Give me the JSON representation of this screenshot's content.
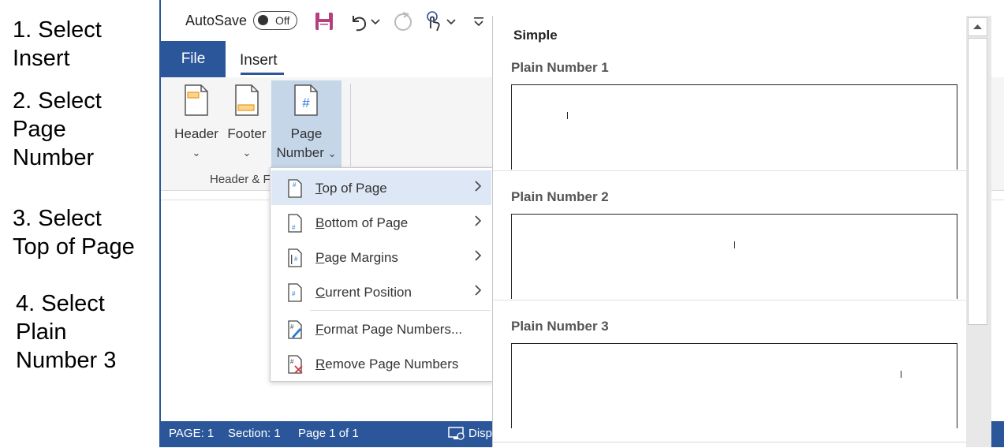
{
  "steps": [
    "1. Select\nInsert",
    "2. Select\nPage\nNumber",
    "3. Select\nTop of Page",
    "4. Select\nPlain\nNumber 3"
  ],
  "qat": {
    "autosave_label": "AutoSave",
    "autosave_state": "Off",
    "icons": [
      "save-icon",
      "undo-icon",
      "redo-icon",
      "touch-mode-icon",
      "customize-qat-icon"
    ]
  },
  "tabs": {
    "file": "File",
    "insert": "Insert"
  },
  "ribbon": {
    "header_label": "Header",
    "footer_label": "Footer",
    "page_number_line1": "Page",
    "page_number_line2": "Number",
    "group_label": "Header & F"
  },
  "menu": {
    "items": [
      {
        "label": "Top of Page",
        "underline": "T",
        "rest": "op of Page"
      },
      {
        "label": "Bottom of Page",
        "underline": "B",
        "rest": "ottom of Page"
      },
      {
        "label": "Page Margins",
        "underline": "P",
        "rest": "age Margins"
      },
      {
        "label": "Current Position",
        "underline": "C",
        "rest": "urrent Position"
      },
      {
        "label": "Format Page Numbers...",
        "underline": "F",
        "rest": "ormat Page Numbers..."
      },
      {
        "label": "Remove Page Numbers",
        "underline": "R",
        "rest": "emove Page Numbers"
      }
    ]
  },
  "gallery": {
    "heading": "Simple",
    "options": [
      {
        "title": "Plain Number 1",
        "align": "left"
      },
      {
        "title": "Plain Number 2",
        "align": "center"
      },
      {
        "title": "Plain Number 3",
        "align": "right"
      }
    ]
  },
  "status": {
    "page": "PAGE: 1",
    "section": "Section: 1",
    "page_of": "Page 1 of 1",
    "display": "Disp"
  },
  "colors": {
    "accent": "#2b579a",
    "highlight": "#dde7f5",
    "active_button": "#c5d6e9"
  }
}
